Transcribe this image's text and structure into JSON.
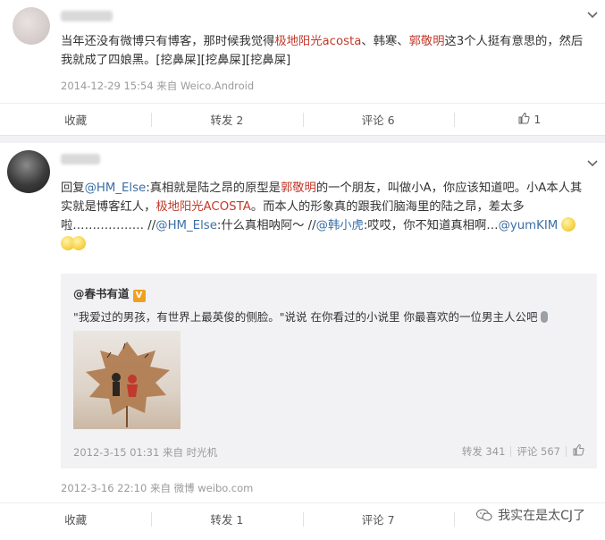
{
  "post1": {
    "content": {
      "p1": "当年还没有微博只有博客，那时候我觉得",
      "h1": "极地阳光acosta",
      "p2": "、韩寒、",
      "h2": "郭敬明",
      "p3": "这3个人挺有意思的，然后我就成了四娘黑。[挖鼻屎][挖鼻屎][挖鼻屎]"
    },
    "meta": "2014-12-29 15:54 来自 Weico.Android",
    "actions": {
      "fav": "收藏",
      "repost": "转发 2",
      "comment": "评论 6",
      "like": "1"
    }
  },
  "post2": {
    "content": {
      "reply": "回复",
      "m1": "@HM_Else",
      "t1": ":真相就是陆之昂的原型是",
      "h1": "郭敬明",
      "t2": "的一个朋友，叫做小A，你应该知道吧。小A本人其实就是博客红人，",
      "h2": "极地阳光ACOSTA",
      "t3": "。而本人的形象真的跟我们脑海里的陆之昂，差太多啦……………… //",
      "m2": "@HM_Else",
      "t4": ":什么真相呐阿～ //",
      "m3": "@韩小虎",
      "t5": ":哎哎，你不知道真相啊…",
      "m4": "@yumKIM"
    },
    "repost": {
      "user": "@春书有道",
      "badge": "V",
      "text": "\"我爱过的男孩，有世界上最英俊的侧脸。\"说说 在你看过的小说里 你最喜欢的一位男主人公吧",
      "meta": "2012-3-15 01:31 来自 时光机",
      "repost_count": "转发 341",
      "comment_count": "评论 567"
    },
    "meta": "2012-3-16 22:10 来自 微博 weibo.com",
    "actions": {
      "fav": "收藏",
      "repost": "转发 1",
      "comment": "评论 7"
    }
  },
  "watermark": {
    "text": "我实在是太CJ了"
  },
  "icons": {
    "chevron": "chevron-down-icon",
    "like": "thumbs-up-icon",
    "emoji": "smile-emoji-icon",
    "wechat": "wechat-icon",
    "mic": "microphone-icon"
  },
  "colors": {
    "highlight": "#c2392b",
    "mention": "#3b6ea5",
    "meta": "#9a9a9a"
  }
}
